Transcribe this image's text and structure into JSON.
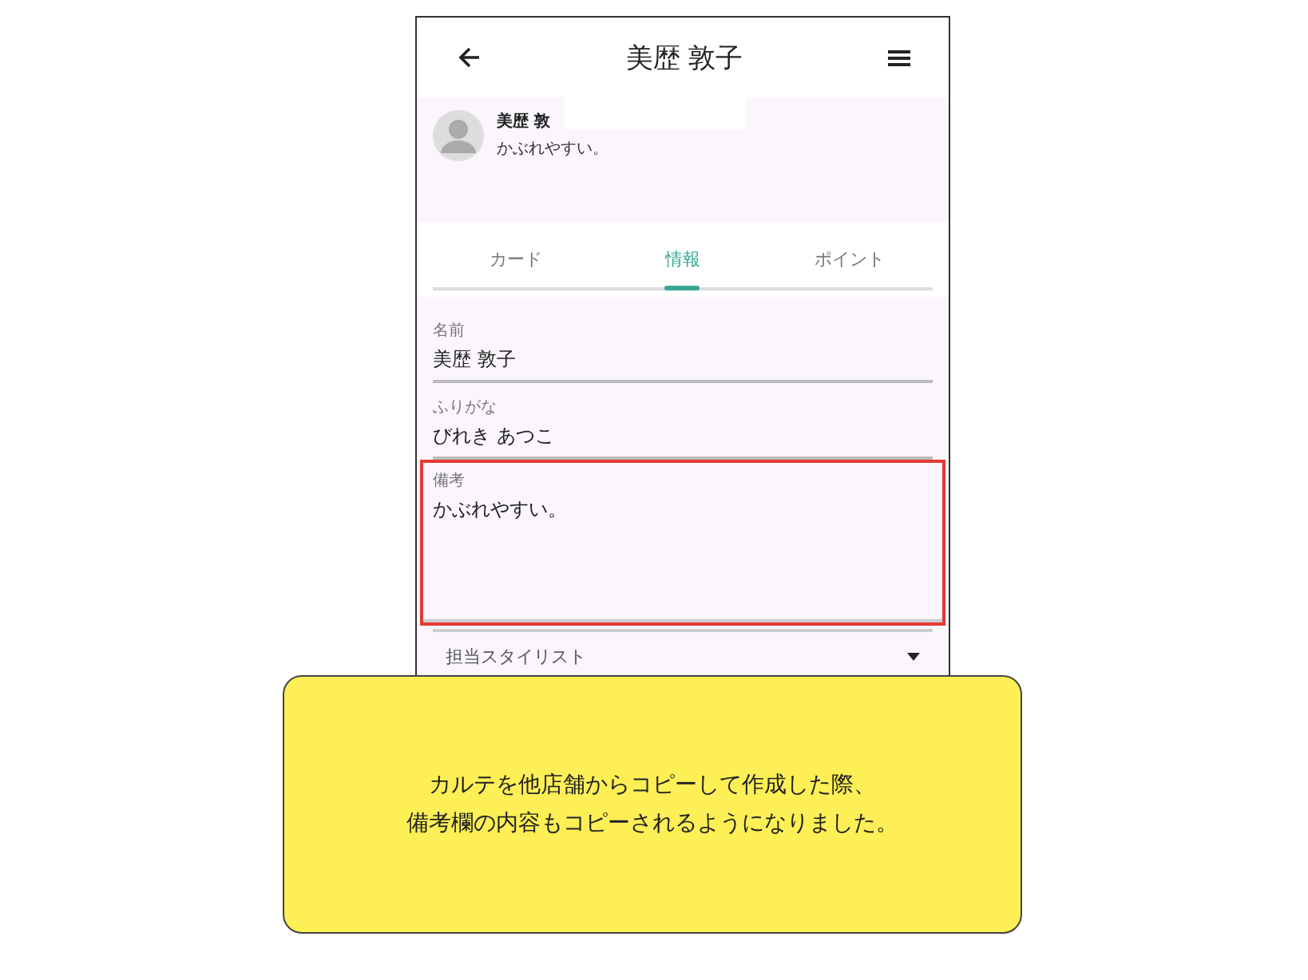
{
  "app_bar": {
    "title": "美歴 敦子"
  },
  "profile": {
    "name": "美歴 敦",
    "note": "かぶれやすい。"
  },
  "tabs": [
    {
      "label": "カード",
      "selected": false
    },
    {
      "label": "情報",
      "selected": true
    },
    {
      "label": "ポイント",
      "selected": false
    }
  ],
  "fields": [
    {
      "kind": "text",
      "label": "名前",
      "value": "美歴 敦子",
      "highlighted": false
    },
    {
      "kind": "text",
      "label": "ふりがな",
      "value": "びれき あつこ",
      "highlighted": false
    },
    {
      "kind": "multiline",
      "label": "備考",
      "value": "かぶれやすい。",
      "highlighted": true
    },
    {
      "kind": "dropdown",
      "label": "担当スタイリスト"
    }
  ],
  "callout": {
    "lines": [
      "カルテを他店舗からコピーして作成した際、",
      "備考欄の内容もコピーされるようになりました。"
    ]
  }
}
